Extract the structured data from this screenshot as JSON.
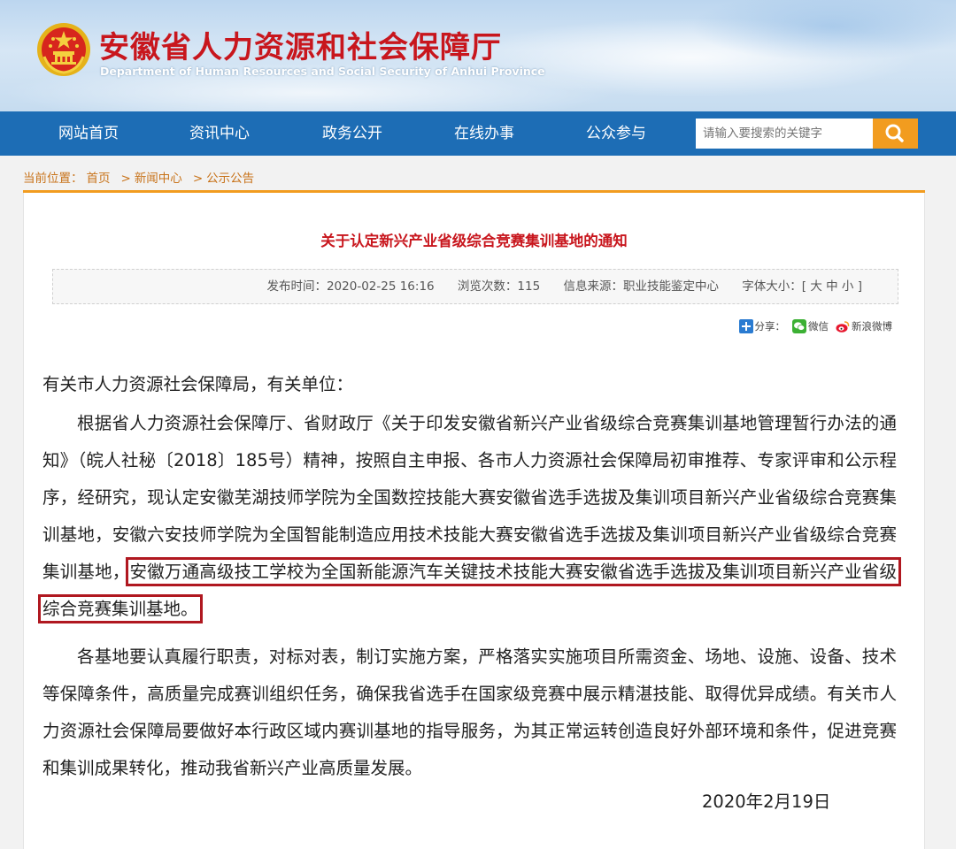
{
  "header": {
    "title": "安徽省人力资源和社会保障厅",
    "subtitle": "Department of Human Resources and Social Security of Anhui Province"
  },
  "nav": {
    "items": [
      "网站首页",
      "资讯中心",
      "政务公开",
      "在线办事",
      "公众参与"
    ],
    "search_placeholder": "请输入要搜索的关键字"
  },
  "breadcrumb": {
    "label": "当前位置：",
    "items": [
      "首页",
      "新闻中心",
      "公示公告"
    ],
    "separator": ">"
  },
  "article": {
    "title": "关于认定新兴产业省级综合竞赛集训基地的通知",
    "meta": {
      "publish_time": "发布时间：2020-02-25 16:16",
      "views": "浏览次数：115",
      "source": "信息来源：职业技能鉴定中心",
      "font_size": "字体大小：[ 大  中  小 ]"
    },
    "share": {
      "label": "分享：",
      "wechat": "微信",
      "weibo": "新浪微博"
    },
    "salutation": "有关市人力资源社会保障局，有关单位：",
    "para1_before": "根据省人力资源社会保障厅、省财政厅《关于印发安徽省新兴产业省级综合竞赛集训基地管理暂行办法的通知》（皖人社秘〔2018〕185号）精神，按照自主申报、各市人力资源社会保障局初审推荐、专家评审和公示程序，经研究，现认定安徽芜湖技师学院为全国数控技能大赛安徽省选手选拔及集训项目新兴产业省级综合竞赛集训基地，安徽六安技师学院为全国智能制造应用技术技能大赛安徽省选手选拔及集训项目新兴产业省级综合竞赛集训基地，",
    "para1_highlight": "安徽万通高级技工学校为全国新能源汽车关键技术技能大赛安徽省选手选拔及集训项目新兴产业省级综合竞赛集训基地。",
    "para2": "各基地要认真履行职责，对标对表，制订实施方案，严格落实实施项目所需资金、场地、设施、设备、技术等保障条件，高质量完成赛训组织任务，确保我省选手在国家级竞赛中展示精湛技能、取得优异成绩。有关市人力资源社会保障局要做好本行政区域内赛训基地的指导服务，为其正常运转创造良好外部环境和条件，促进竞赛和集训成果转化，推动我省新兴产业高质量发展。",
    "date": "2020年2月19日"
  },
  "colors": {
    "brand_red": "#c8161d",
    "nav_blue": "#1d6db5",
    "accent_orange": "#f29c1f",
    "highlight_border": "#b01820"
  }
}
